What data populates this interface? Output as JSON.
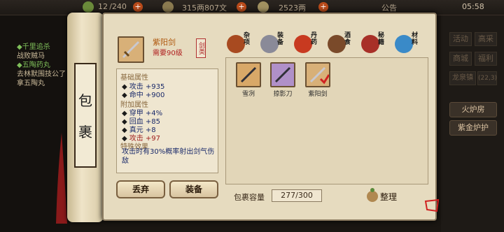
{
  "topbar": {
    "stamina": "12 /240",
    "coins": "315两807文",
    "silver": "2523两",
    "notice": "公告",
    "time": "05:58"
  },
  "quests": [
    {
      "text": "◆千里追杀",
      "green": true
    },
    {
      "text": "战败贼马",
      "green": false
    },
    {
      "text": "◆五陶药丸",
      "green": true
    },
    {
      "text": "去林默围技公了",
      "green": false
    },
    {
      "text": "拿五陶丸",
      "green": false
    }
  ],
  "right_menu": {
    "r1a": "活动",
    "r1b": "高采",
    "r2a": "商城",
    "r2b": "福利",
    "location": "龙泉镇",
    "location_coord": "(22,3)",
    "btn_furnace": "火炉房",
    "btn_gold": "紫金炉护"
  },
  "scroll_title": [
    "包",
    "裹"
  ],
  "item": {
    "name": "紫阳剑",
    "requirement": "需要90级",
    "tag": "剑类"
  },
  "stats": {
    "base_header": "基础属性",
    "base": [
      "攻击 +935",
      "命中 +900"
    ],
    "extra_header": "附加属性",
    "extra": [
      {
        "t": "穿甲 +4%",
        "red": false
      },
      {
        "t": "回血 +85",
        "red": false
      },
      {
        "t": "真元 +8",
        "red": false
      },
      {
        "t": "攻击 +97",
        "red": true
      }
    ],
    "special_header": "特殊效果",
    "special": "攻击时有30%概率射出剑气伤敌"
  },
  "buttons": {
    "discard": "丢弃",
    "equip": "装备"
  },
  "tabs": [
    "杂项",
    "装备",
    "丹药",
    "酒食",
    "秘籍",
    "材料"
  ],
  "bag_items": [
    "雪冽",
    "掠影刀",
    "紫阳剑"
  ],
  "capacity": {
    "label": "包裹容量",
    "value": "277/300"
  },
  "sort_label": "整理",
  "colors": {
    "panel": "#e6dbbf",
    "accent": "#b03030"
  }
}
